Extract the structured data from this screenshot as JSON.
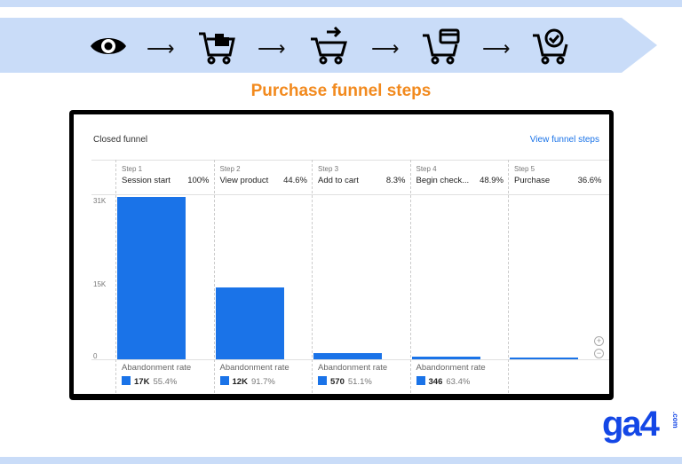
{
  "header": {
    "title": "Purchase funnel steps",
    "icons": [
      "eye-icon",
      "cart-bags-icon",
      "cart-add-icon",
      "cart-card-icon",
      "cart-check-icon"
    ]
  },
  "panel": {
    "title": "Closed funnel",
    "link": "View funnel steps",
    "y_ticks": [
      "31K",
      "15K",
      "0"
    ],
    "steps": [
      {
        "step": "Step 1",
        "label": "Session start",
        "pct": "100%",
        "users": 31000,
        "ab_label": "Abandonment rate",
        "ab_count": "17K",
        "ab_rate": "55.4%"
      },
      {
        "step": "Step 2",
        "label": "View product",
        "pct": "44.6%",
        "users": 13800,
        "ab_label": "Abandonment rate",
        "ab_count": "12K",
        "ab_rate": "91.7%"
      },
      {
        "step": "Step 3",
        "label": "Add to cart",
        "pct": "8.3%",
        "users": 1150,
        "ab_label": "Abandonment rate",
        "ab_count": "570",
        "ab_rate": "51.1%"
      },
      {
        "step": "Step 4",
        "label": "Begin check...",
        "pct": "48.9%",
        "users": 560,
        "ab_label": "Abandonment rate",
        "ab_count": "346",
        "ab_rate": "63.4%"
      },
      {
        "step": "Step 5",
        "label": "Purchase",
        "pct": "36.6%",
        "users": 205
      }
    ]
  },
  "logo": {
    "text": "ga4",
    "suffix": ".com"
  },
  "colors": {
    "accent": "#1a73e8",
    "title": "#f28a1e",
    "banner": "#c9dcf8"
  }
}
